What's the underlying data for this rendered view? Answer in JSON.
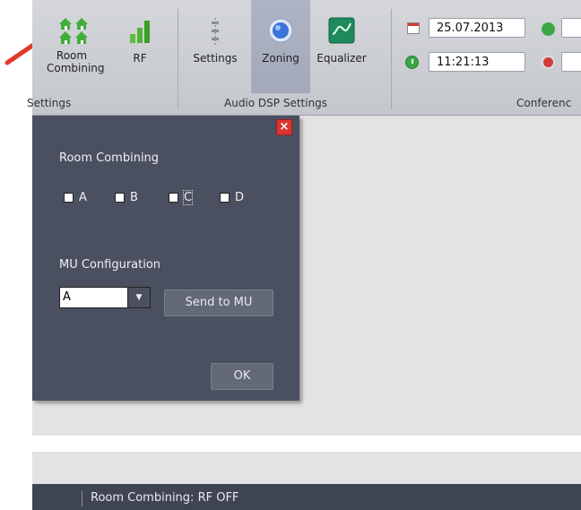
{
  "ribbon": {
    "buttons": {
      "room_combining": "Room\nCombining",
      "rf": "RF",
      "settings": "Settings",
      "zoning": "Zoning",
      "equalizer": "Equalizer"
    },
    "groups": {
      "settings": "Settings",
      "audio_dsp": "Audio DSP Settings",
      "conference": "Conferenc"
    },
    "date": "25.07.2013",
    "time": "11:21:13"
  },
  "dialog": {
    "close": "×",
    "room_combining_label": "Room Combining",
    "checkboxes": [
      {
        "label": "A",
        "checked": false
      },
      {
        "label": "B",
        "checked": false
      },
      {
        "label": "C",
        "checked": false
      },
      {
        "label": "D",
        "checked": false
      }
    ],
    "mu_config_label": "MU Configuration",
    "mu_selected": "A",
    "send_button": "Send to MU",
    "ok_button": "OK"
  },
  "status": {
    "text": "Room Combining: RF OFF"
  },
  "colors": {
    "dialog_bg": "#4b5060",
    "status_bg": "#3f4452",
    "arrow": "#e03a2a",
    "close": "#d9362f"
  }
}
